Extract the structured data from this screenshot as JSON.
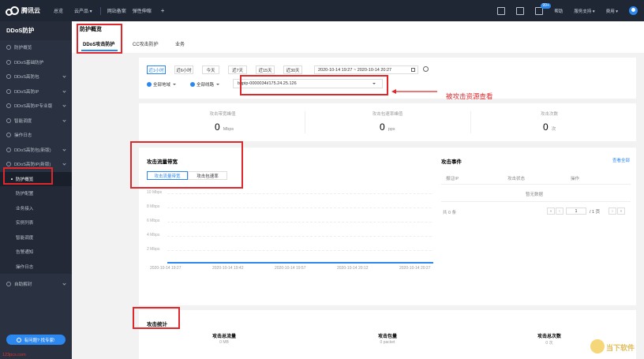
{
  "topbar": {
    "logo_text": "腾讯云",
    "nav": [
      "总览",
      "云产品 ▾",
      "网站备案",
      "弹性伸缩",
      "+"
    ],
    "badge": "99+",
    "right": [
      "帮助",
      "服务支持 ▾",
      "费用 ▾"
    ]
  },
  "sidebar": {
    "title": "DDoS防护",
    "items": [
      {
        "label": "防护概览",
        "chevron": false
      },
      {
        "label": "DDoS基础防护",
        "chevron": false
      },
      {
        "label": "DDoS高防包",
        "chevron": true
      },
      {
        "label": "DDoS高防IP",
        "chevron": true
      },
      {
        "label": "DDoS高防IP专业版",
        "chevron": true
      },
      {
        "label": "智能调度",
        "chevron": true
      },
      {
        "label": "操作日志",
        "chevron": false
      },
      {
        "label": "DDoS高防包(新版)",
        "chevron": true
      },
      {
        "label": "DDoS高防IP(新版)",
        "chevron": true
      }
    ],
    "subitems": [
      "防护概览",
      "防护配置",
      "业务接入",
      "实例列表",
      "智能调度",
      "告警通知",
      "操作日志"
    ],
    "bottom_item": "自助解封",
    "help": "有问题? 找专家!",
    "footer": "123pcs.com"
  },
  "page": {
    "title": "防护概览",
    "tabs": [
      "DDoS攻击防护",
      "CC攻击防护",
      "业务"
    ]
  },
  "filter": {
    "ranges": [
      "近1小时",
      "近6小时",
      "今天",
      "近7天",
      "近15天",
      "近30天"
    ],
    "datetime": "2020-10-14 19:27 ~ 2020-10-14 20:27",
    "region": "全部地域",
    "line": "全部线路",
    "ip": "bgpip-0000034i/175.24.25.126"
  },
  "annotation": "被攻击资源查看",
  "metrics": [
    {
      "label": "攻击带宽峰值",
      "value": "0",
      "unit": "Mbps"
    },
    {
      "label": "攻击包速率峰值",
      "value": "0",
      "unit": "pps"
    },
    {
      "label": "攻击次数",
      "value": "0",
      "unit": "次"
    }
  ],
  "traffic": {
    "title": "攻击流量带宽",
    "tabs": [
      "攻击流量带宽",
      "攻击包速率"
    ],
    "yticks": [
      "10 Mbps",
      "8 Mbps",
      "6 Mbps",
      "4 Mbps",
      "2 Mbps"
    ],
    "xticks": [
      "2020-10-14 19:27",
      "2020-10-14 19:42",
      "2020-10-14 19:57",
      "2020-10-14 20:12",
      "2020-10-14 20:27"
    ]
  },
  "events": {
    "title": "攻击事件",
    "link": "查看全部",
    "cols": [
      "报证IP",
      "攻击状态",
      "操作"
    ],
    "empty": "暂无数据",
    "total": "共 0 条",
    "page": "1",
    "pages": "/ 1 页"
  },
  "stats": {
    "title": "攻击统计",
    "items": [
      {
        "label": "攻击总流量",
        "value": "0 MB"
      },
      {
        "label": "攻击包量",
        "value": "0 packet"
      },
      {
        "label": "攻击总次数",
        "value": "0 次"
      }
    ]
  },
  "watermark": "当下软件"
}
